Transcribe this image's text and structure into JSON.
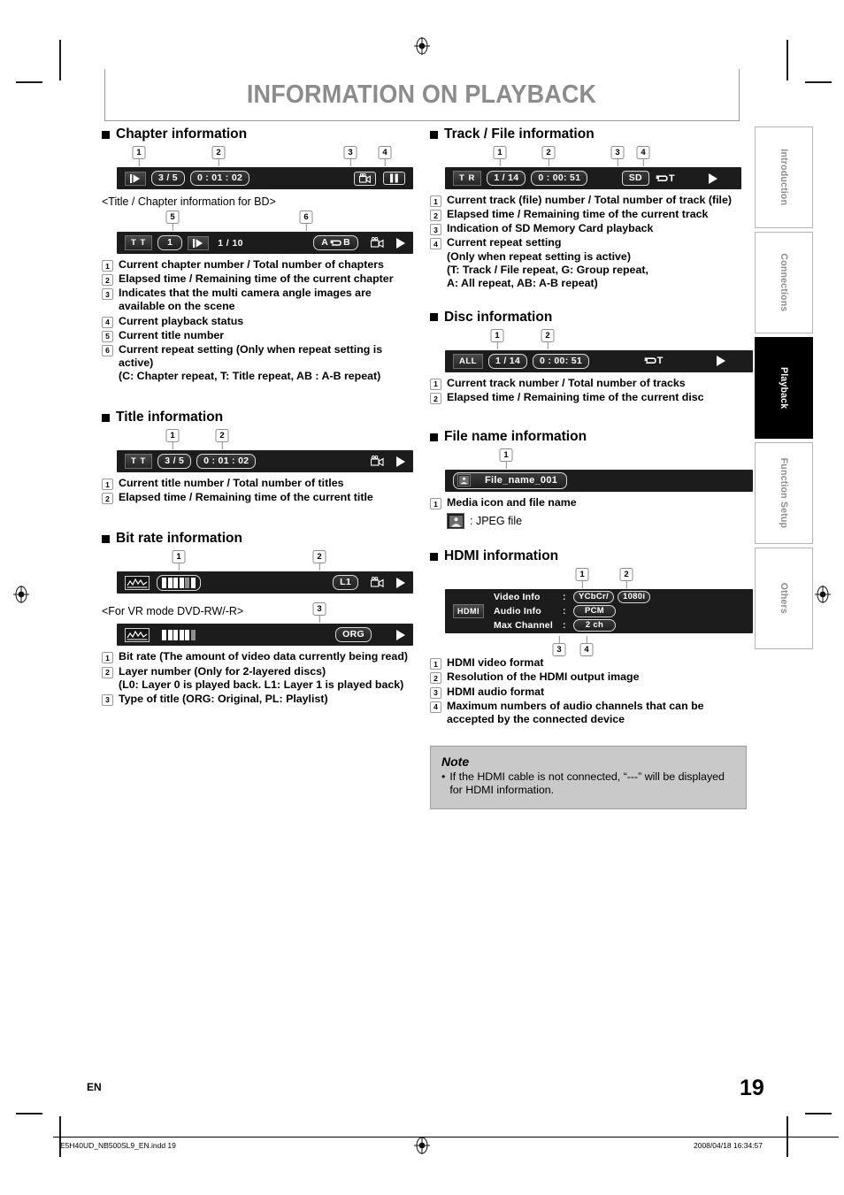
{
  "page": {
    "title": "INFORMATION ON PLAYBACK",
    "language_code": "EN",
    "page_number": "19",
    "footer_file": "E5H40UD_NB500SL9_EN.indd   19",
    "footer_timestamp": "2008/04/18   16:34:57"
  },
  "tabs": [
    {
      "label": "Introduction",
      "active": false
    },
    {
      "label": "Connections",
      "active": false
    },
    {
      "label": "Playback",
      "active": true
    },
    {
      "label": "Function Setup",
      "active": false
    },
    {
      "label": "Others",
      "active": false
    }
  ],
  "left": {
    "chapter": {
      "heading": "Chapter information",
      "callouts": [
        "1",
        "2",
        "3",
        "4"
      ],
      "osd": {
        "play_icon": "play-small-icon",
        "chapter": "3 / 5",
        "time": "0 : 01 : 02",
        "angle_icon": "camera-angle-icon",
        "pause_icon": "pause-icon"
      },
      "sub_caption": "<Title / Chapter information for BD>",
      "bd_callouts": [
        "5",
        "6"
      ],
      "bd_osd": {
        "tt_tag": "T T",
        "title_number": "1",
        "play_icon": "play-small-icon",
        "chapter": "1 / 10",
        "repeat": "A ↺ B",
        "repeat_a": "A",
        "repeat_b": "B",
        "angle_icon": "camera-angle-icon",
        "play_status_icon": "play-icon"
      },
      "items": [
        {
          "n": "1",
          "text": "Current chapter number / Total number of chapters"
        },
        {
          "n": "2",
          "text": "Elapsed time / Remaining time of the current chapter"
        },
        {
          "n": "3",
          "text": "Indicates that the multi camera angle images are available on the scene"
        },
        {
          "n": "4",
          "text": "Current playback status"
        },
        {
          "n": "5",
          "text": "Current title number"
        },
        {
          "n": "6",
          "text": "Current repeat setting (Only when repeat setting is active)\n(C: Chapter repeat, T: Title repeat, AB : A-B repeat)"
        }
      ]
    },
    "title": {
      "heading": "Title information",
      "callouts": [
        "1",
        "2"
      ],
      "osd": {
        "tt_tag": "T T",
        "title": "3 / 5",
        "time": "0 : 01 : 02",
        "angle_icon": "camera-angle-icon",
        "play_status_icon": "play-icon"
      },
      "items": [
        {
          "n": "1",
          "text": "Current title number / Total number of titles"
        },
        {
          "n": "2",
          "text": "Elapsed time / Remaining time of the current title"
        }
      ]
    },
    "bitrate": {
      "heading": "Bit rate information",
      "callouts": [
        "1",
        "2"
      ],
      "osd": {
        "wave_icon": "bitrate-wave-icon",
        "meter_segments": [
          "on",
          "on",
          "on",
          "on",
          "off",
          "on"
        ],
        "layer": "L1",
        "angle_icon": "camera-angle-icon",
        "play_status_icon": "play-icon"
      },
      "sub_caption": "<For VR mode DVD-RW/-R>",
      "vr_callouts": [
        "3"
      ],
      "vr_osd": {
        "wave_icon": "bitrate-wave-icon",
        "meter_segments": [
          "on",
          "on",
          "on",
          "on",
          "on",
          "off"
        ],
        "title_type": "ORG",
        "play_status_icon": "play-icon"
      },
      "items": [
        {
          "n": "1",
          "text": "Bit rate (The amount of video data currently being read)"
        },
        {
          "n": "2",
          "text": "Layer number (Only for 2-layered discs)\n(L0: Layer 0 is played back. L1: Layer 1 is played back)"
        },
        {
          "n": "3",
          "text": "Type of title (ORG: Original, PL: Playlist)"
        }
      ]
    }
  },
  "right": {
    "track": {
      "heading": "Track / File information",
      "callouts": [
        "1",
        "2",
        "3",
        "4"
      ],
      "osd": {
        "tr_tag": "T R",
        "track": "1 / 14",
        "time": "0 : 00: 51",
        "sd": "SD",
        "repeat": "T",
        "play_status_icon": "play-icon"
      },
      "items": [
        {
          "n": "1",
          "text": "Current track (file) number / Total number of track (file)"
        },
        {
          "n": "2",
          "text": "Elapsed time / Remaining time of the current track"
        },
        {
          "n": "3",
          "text": "Indication of SD Memory Card playback"
        },
        {
          "n": "4",
          "text": "Current repeat setting\n(Only when repeat setting is active)\n(T: Track / File repeat, G: Group repeat,\nA: All repeat, AB: A-B repeat)"
        }
      ]
    },
    "disc": {
      "heading": "Disc information",
      "callouts": [
        "1",
        "2"
      ],
      "osd": {
        "all_tag": "ALL",
        "track": "1 / 14",
        "time": "0 : 00: 51",
        "repeat": "T",
        "play_status_icon": "play-icon"
      },
      "items": [
        {
          "n": "1",
          "text": "Current track number / Total number of tracks"
        },
        {
          "n": "2",
          "text": "Elapsed time / Remaining time of the current disc"
        }
      ]
    },
    "filename": {
      "heading": "File name information",
      "callouts": [
        "1"
      ],
      "osd": {
        "media_icon": "jpeg-file-icon",
        "name": "File_name_001"
      },
      "items": [
        {
          "n": "1",
          "text": "Media icon and file name"
        }
      ],
      "legend": {
        "icon": "jpeg-file-icon",
        "text": ": JPEG file"
      }
    },
    "hdmi": {
      "heading": "HDMI information",
      "callouts_top": [
        "1",
        "2"
      ],
      "callouts_bottom": [
        "3",
        "4"
      ],
      "osd": {
        "hdmi_tag": "HDMI",
        "rows": [
          {
            "label": "Video Info",
            "colon": ":",
            "values": [
              "YCbCr/",
              "1080i"
            ]
          },
          {
            "label": "Audio Info",
            "colon": ":",
            "values": [
              "PCM"
            ]
          },
          {
            "label": "Max Channel",
            "colon": ":",
            "values": [
              "2 ch"
            ]
          }
        ]
      },
      "items": [
        {
          "n": "1",
          "text": "HDMI video format"
        },
        {
          "n": "2",
          "text": "Resolution of the HDMI output image"
        },
        {
          "n": "3",
          "text": "HDMI audio format"
        },
        {
          "n": "4",
          "text": "Maximum numbers of audio channels that can be accepted by the connected device"
        }
      ]
    },
    "note": {
      "title": "Note",
      "bullet": "•",
      "text": "If the HDMI cable is not connected, “---” will be displayed for HDMI information."
    }
  },
  "colors": {
    "osd_background": "#1c1c1c",
    "title_gray": "#8c8c8c",
    "note_background": "#c9c9c9",
    "tab_active": "#000000"
  }
}
